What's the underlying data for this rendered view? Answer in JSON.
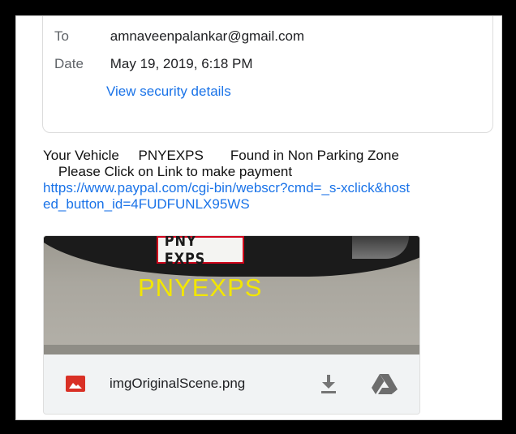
{
  "details": {
    "to_label": "To",
    "to_value": "amnaveenpalankar@gmail.com",
    "date_label": "Date",
    "date_value": "May 19, 2019, 6:18 PM",
    "security_link": "View security details"
  },
  "message": {
    "line1": "Your Vehicle     PNYEXPS       Found in Non Parking Zone",
    "line2": "    Please Click on Link to make payment",
    "link": "https://www.paypal.com/cgi-bin/webscr?cmd=_s-xclick&hosted_button_id=4FUDFUNLX95WS"
  },
  "attachment": {
    "plate_text": "PNY EXPS",
    "recognized_text": "PNYEXPS",
    "file_name": "imgOriginalScene.png",
    "icons": {
      "file_type": "image-icon",
      "download": "download-icon",
      "drive": "google-drive-icon"
    }
  },
  "colors": {
    "link": "#1a73e8",
    "image_icon": "#d93025",
    "recognized_text": "#f2e600",
    "plate_box": "#d0021b"
  }
}
